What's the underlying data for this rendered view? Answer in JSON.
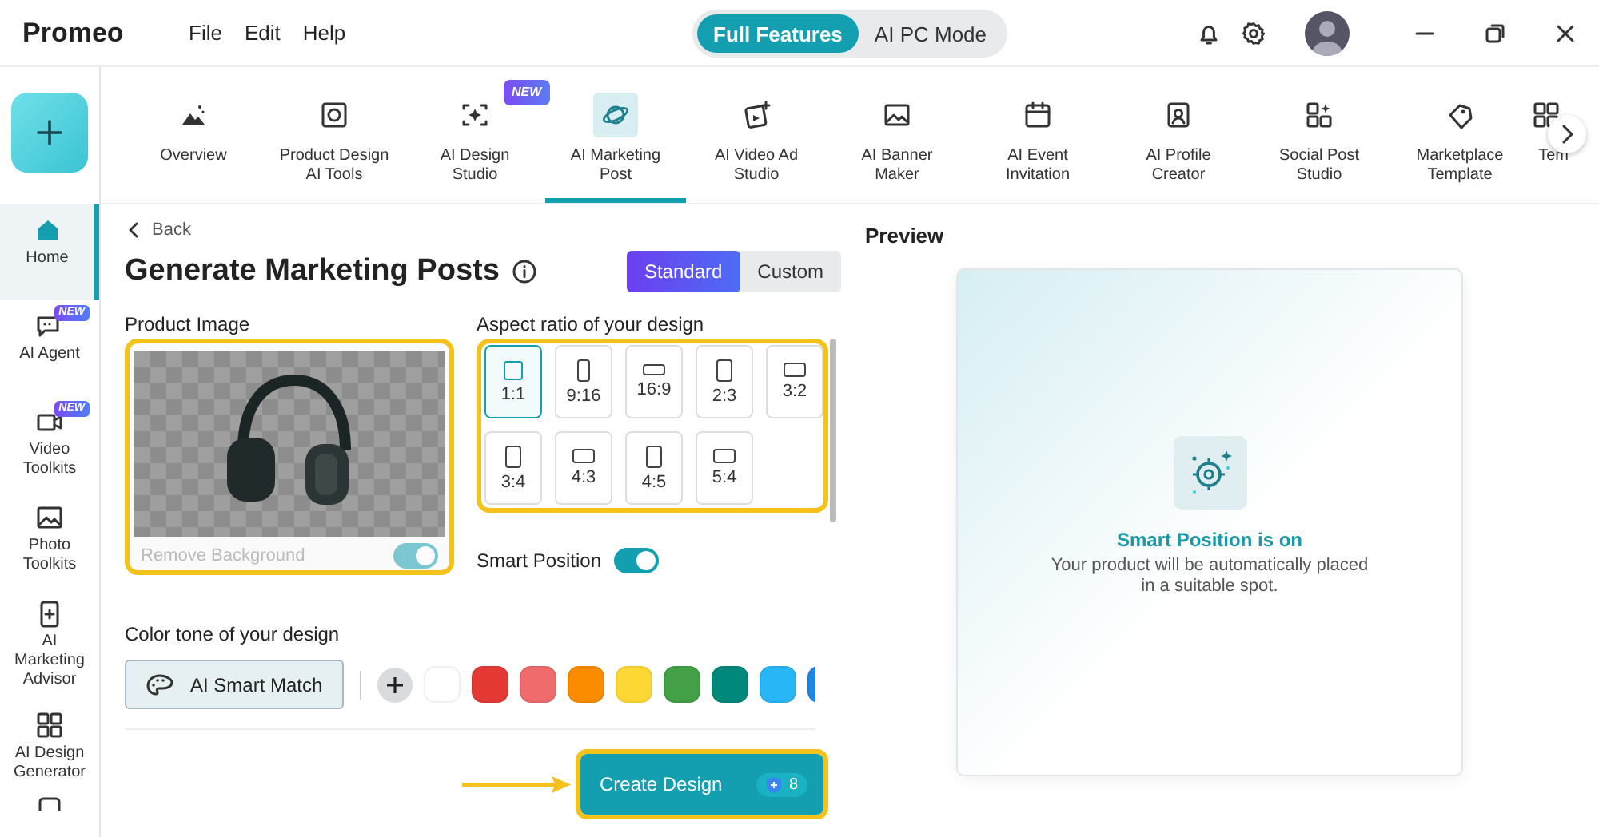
{
  "app": {
    "name": "Promeo",
    "menu": [
      "File",
      "Edit",
      "Help"
    ],
    "modes": [
      {
        "label": "Full Features",
        "selected": true
      },
      {
        "label": "AI PC Mode",
        "selected": false
      }
    ]
  },
  "sidebar": {
    "items": [
      {
        "label": "Home",
        "selected": true
      },
      {
        "label": "AI Agent",
        "selected": false,
        "badge": "NEW"
      },
      {
        "label": "Video\nToolkits",
        "selected": false,
        "badge": "NEW"
      },
      {
        "label": "Photo\nToolkits",
        "selected": false
      },
      {
        "label": "AI\nMarketing\nAdvisor",
        "selected": false
      },
      {
        "label": "AI Design\nGenerator",
        "selected": false
      }
    ]
  },
  "tools": [
    {
      "label": "Overview",
      "selected": false
    },
    {
      "label": "Product Design\nAI Tools",
      "selected": false
    },
    {
      "label": "AI Design\nStudio",
      "selected": false,
      "badge": "NEW"
    },
    {
      "label": "AI Marketing\nPost",
      "selected": true
    },
    {
      "label": "AI Video Ad\nStudio",
      "selected": false
    },
    {
      "label": "AI Banner\nMaker",
      "selected": false
    },
    {
      "label": "AI Event\nInvitation",
      "selected": false
    },
    {
      "label": "AI Profile\nCreator",
      "selected": false
    },
    {
      "label": "Social Post\nStudio",
      "selected": false
    },
    {
      "label": "Marketplace\nTemplate",
      "selected": false
    },
    {
      "label": "Tem",
      "selected": false
    }
  ],
  "form": {
    "back": "Back",
    "title": "Generate Marketing Posts",
    "style_tabs": [
      {
        "label": "Standard",
        "selected": true
      },
      {
        "label": "Custom",
        "selected": false
      }
    ],
    "product_image": {
      "label": "Product Image",
      "highlighted": true,
      "remove_background": {
        "label": "Remove Background",
        "on": true,
        "disabled": true
      }
    },
    "aspect_ratio": {
      "label": "Aspect ratio of your design",
      "highlighted": true,
      "options": [
        {
          "label": "1:1",
          "kind": "square",
          "selected": true
        },
        {
          "label": "9:16",
          "kind": "tall",
          "selected": false
        },
        {
          "label": "16:9",
          "kind": "wide",
          "selected": false
        },
        {
          "label": "2:3",
          "kind": "portrait",
          "selected": false
        },
        {
          "label": "3:2",
          "kind": "landscape",
          "selected": false
        },
        {
          "label": "3:4",
          "kind": "portrait",
          "selected": false
        },
        {
          "label": "4:3",
          "kind": "landscape",
          "selected": false
        },
        {
          "label": "4:5",
          "kind": "portrait",
          "selected": false
        },
        {
          "label": "5:4",
          "kind": "landscape",
          "selected": false
        }
      ]
    },
    "smart_position": {
      "label": "Smart Position",
      "on": true
    },
    "color_tone": {
      "label": "Color tone of your design",
      "smart_match": "AI Smart Match",
      "swatches": [
        {
          "color": "#ffffff"
        },
        {
          "color": "#e53935"
        },
        {
          "color": "#f06b6b"
        },
        {
          "color": "#fb8c00"
        },
        {
          "color": "#fdd835"
        },
        {
          "color": "#43a047"
        },
        {
          "color": "#00897b"
        },
        {
          "color": "#29b6f6"
        },
        {
          "color": "#1e88e5"
        }
      ]
    },
    "create": {
      "label": "Create Design",
      "credits": "8",
      "highlighted": true
    }
  },
  "preview": {
    "title": "Preview",
    "status_title": "Smart Position is on",
    "status_text": "Your product will be automatically placed\nin a suitable spot."
  }
}
